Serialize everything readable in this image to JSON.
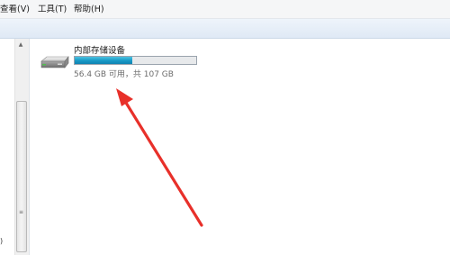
{
  "menubar": {
    "items": [
      "查看(V)",
      "工具(T)",
      "帮助(H)"
    ]
  },
  "sidebar": {
    "edge_text": ")"
  },
  "drive": {
    "name": "内部存储设备",
    "size_text": "56.4 GB 可用，共 107 GB",
    "used_fraction": 0.473,
    "bar_color": "#1a9bc8",
    "icon": "hard-drive-icon"
  },
  "annotation": {
    "color": "#e8302a",
    "icon": "red-arrow-annotation"
  }
}
